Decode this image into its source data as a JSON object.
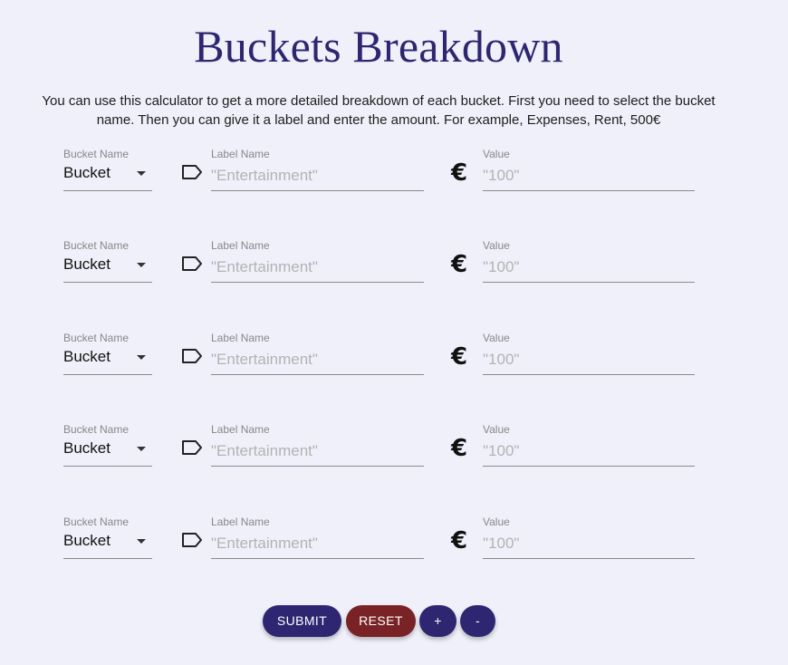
{
  "title": "Buckets Breakdown",
  "intro": "You can use this calculator to get a more detailed breakdown of each bucket. First you need to select the bucket name. Then you can give it a label and enter the amount. For example, Expenses, Rent, 500€",
  "rows": [
    {
      "bucket_label": "Bucket Name",
      "bucket_value": "Bucket",
      "label_label": "Label Name",
      "label_placeholder": "\"Entertainment\"",
      "value_label": "Value",
      "value_placeholder": "\"100\""
    },
    {
      "bucket_label": "Bucket Name",
      "bucket_value": "Bucket",
      "label_label": "Label Name",
      "label_placeholder": "\"Entertainment\"",
      "value_label": "Value",
      "value_placeholder": "\"100\""
    },
    {
      "bucket_label": "Bucket Name",
      "bucket_value": "Bucket",
      "label_label": "Label Name",
      "label_placeholder": "\"Entertainment\"",
      "value_label": "Value",
      "value_placeholder": "\"100\""
    },
    {
      "bucket_label": "Bucket Name",
      "bucket_value": "Bucket",
      "label_label": "Label Name",
      "label_placeholder": "\"Entertainment\"",
      "value_label": "Value",
      "value_placeholder": "\"100\""
    },
    {
      "bucket_label": "Bucket Name",
      "bucket_value": "Bucket",
      "label_label": "Label Name",
      "label_placeholder": "\"Entertainment\"",
      "value_label": "Value",
      "value_placeholder": "\"100\""
    }
  ],
  "icons": {
    "label": "label-tag-icon",
    "value": "euro-icon",
    "currency_symbol": "€"
  },
  "buttons": {
    "submit": "SUBMIT",
    "reset": "RESET",
    "add": "+",
    "remove": "-"
  },
  "colors": {
    "primary": "#2e2670",
    "danger": "#7a2327",
    "background": "#f0f0fa"
  }
}
